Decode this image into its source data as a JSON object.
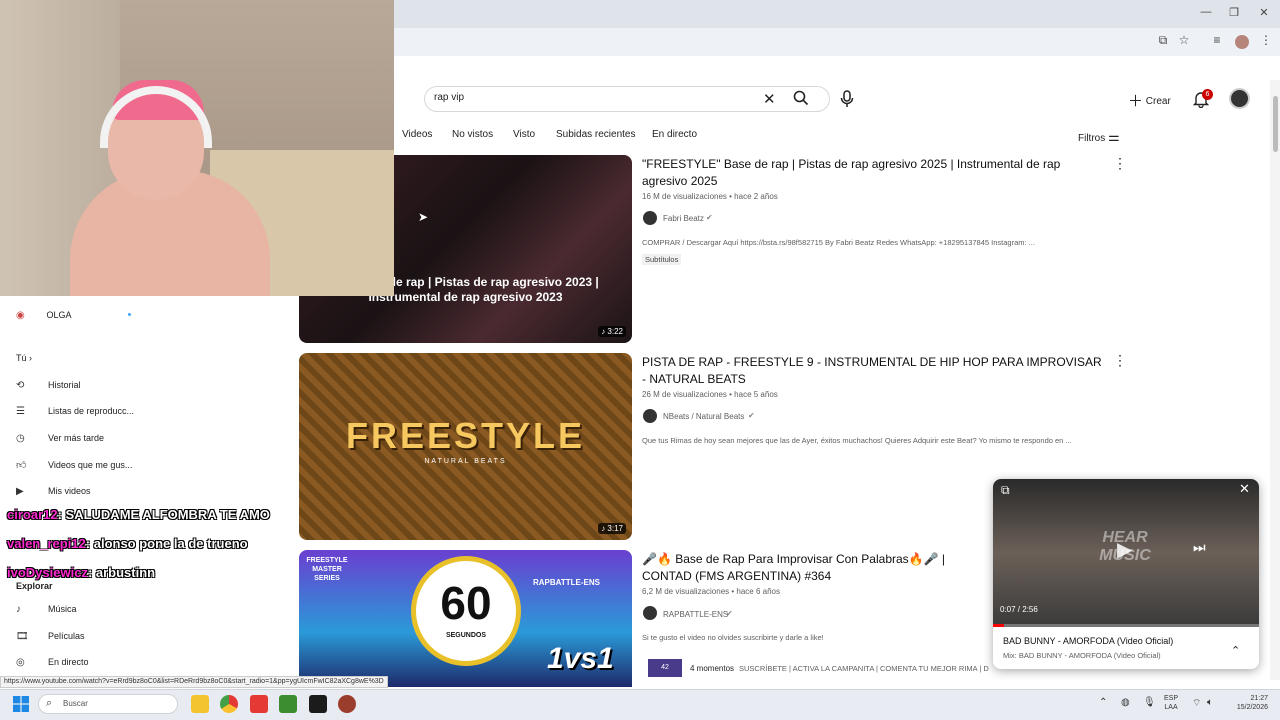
{
  "search": {
    "query": "rap  vip"
  },
  "header": {
    "create_label": "Crear",
    "notification_count": "6"
  },
  "chips": [
    "Videos",
    "No vistos",
    "Visto",
    "Subidas recientes",
    "En directo"
  ],
  "filters_label": "Filtros",
  "results": [
    {
      "title": "\"FREESTYLE\" Base de rap | Pistas de rap agresivo 2025 | Instrumental de rap agresivo 2025",
      "meta": "16 M de visualizaciones • hace 2 años",
      "channel": "Fabri Beatz",
      "description": "COMPRAR / Descargar Aquí https://bsta.rs/98f582715 By Fabri Beatz Redes WhatsApp: +18295137845 Instagram: ...",
      "badge": "Subtítulos",
      "thumb_text": "LE\" Base de rap | Pistas de rap agresivo 2023 | Instrumental de rap agresivo 2023",
      "duration": "3:22"
    },
    {
      "title": "PISTA DE RAP - FREESTYLE 9 - INSTRUMENTAL DE HIP HOP PARA IMPROVISAR - NATURAL BEATS",
      "meta": "26 M de visualizaciones • hace 5 años",
      "channel": "NBeats / Natural Beats",
      "description": "Que tus Rimas de hoy sean mejores que las de Ayer, éxitos muchachos! Quieres Adquirir este Beat? Yo mismo te respondo en ...",
      "thumb_text": "FREESTYLE",
      "thumb_subtext": "NATURAL BEATS",
      "duration": "3:17"
    },
    {
      "title": "🎤🔥 Base de Rap Para Improvisar Con Palabras🔥🎤 | CONTAD (FMS ARGENTINA) #364",
      "meta": "6,2 M de visualizaciones • hace 6 años",
      "channel": "RAPBATTLE-ENS",
      "description": "Si te gusto el video no olvides suscribirte y darle a like!",
      "moments": "4 momentos",
      "moments_text": "SUSCRÍBETE | ACTIVA LA CAMPANITA | COMENTA TU MEJOR RIMA | D",
      "moments_count": "42",
      "thumb_number": "60",
      "thumb_seconds": "SEGUNDOS",
      "thumb_vs": "1vs1",
      "thumb_series": "FREESTYLE MASTER SERIES",
      "thumb_brand": "RAPBATTLE-ENS"
    }
  ],
  "sidebar": {
    "top_item": "OLGA",
    "section_you": "Tú",
    "items": [
      "Historial",
      "Listas de reproducc...",
      "Ver más tarde",
      "Videos que me gus...",
      "Mis videos"
    ],
    "explore_title": "Explorar",
    "explore_items": [
      "Música",
      "Películas",
      "En directo"
    ]
  },
  "chat": [
    {
      "user": "ciroar12",
      "message": ": SALUDAME ALFOMBRA TE AMO"
    },
    {
      "user": "valen_repi12",
      "message": ": alonso pone la de trueno"
    },
    {
      "user": "ivoDysiewicz",
      "message": ": arbustinn"
    }
  ],
  "miniplayer": {
    "time": "0:07 / 2:56",
    "progress": 0.04,
    "title": "BAD BUNNY - AMORFODA (Video Oficial)",
    "subtitle": "Mix: BAD BUNNY - AMORFODA (Video Oficial)",
    "watermark": "HEAR MUSIC"
  },
  "status_url": "https://www.youtube.com/watch?v=eRrd9bz8oC0&list=RDeRrd9bz8oC0&start_radio=1&pp=ygUIcmFwIC82aXCg8wE%3D",
  "taskbar": {
    "search_placeholder": "Buscar",
    "lang": "ESP",
    "lang2": "LAA",
    "time": "21:27",
    "date": "15/2/2026"
  }
}
